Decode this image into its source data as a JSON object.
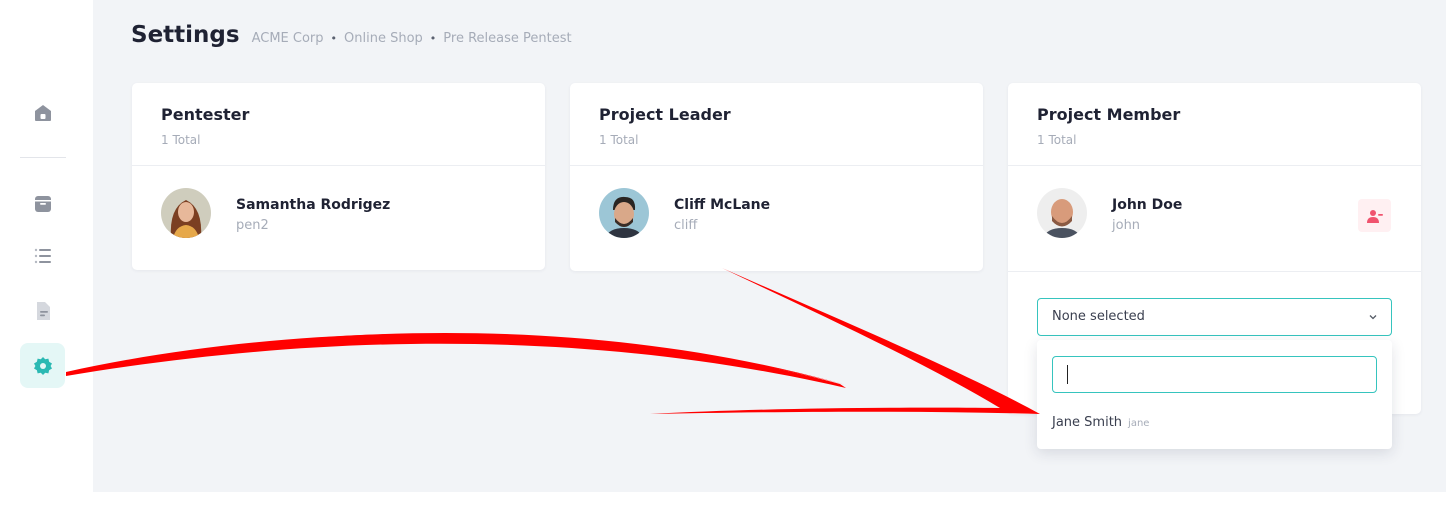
{
  "header": {
    "title": "Settings",
    "breadcrumb": [
      "ACME Corp",
      "Online Shop",
      "Pre Release Pentest"
    ],
    "separator": "•"
  },
  "sidebar": {
    "items": [
      {
        "icon": "home-icon",
        "active": false
      },
      {
        "icon": "archive-icon",
        "active": false
      },
      {
        "icon": "list-icon",
        "active": false
      },
      {
        "icon": "document-icon",
        "active": false
      },
      {
        "icon": "gear-icon",
        "active": true
      }
    ]
  },
  "cards": [
    {
      "title": "Pentester",
      "count": "1 Total",
      "member": {
        "name": "Samantha Rodrigez",
        "username": "pen2"
      }
    },
    {
      "title": "Project Leader",
      "count": "1 Total",
      "member": {
        "name": "Cliff McLane",
        "username": "cliff"
      }
    },
    {
      "title": "Project Member",
      "count": "1 Total",
      "member": {
        "name": "John Doe",
        "username": "john"
      },
      "select": {
        "value": "None selected"
      }
    }
  ],
  "dropdown": {
    "search_value": "",
    "options": [
      {
        "name": "Jane Smith",
        "username": "jane"
      }
    ]
  },
  "colors": {
    "accent": "#36c4be",
    "background": "#f2f4f7",
    "annotation_arrow": "#ff0000",
    "danger": "#f0536e"
  }
}
